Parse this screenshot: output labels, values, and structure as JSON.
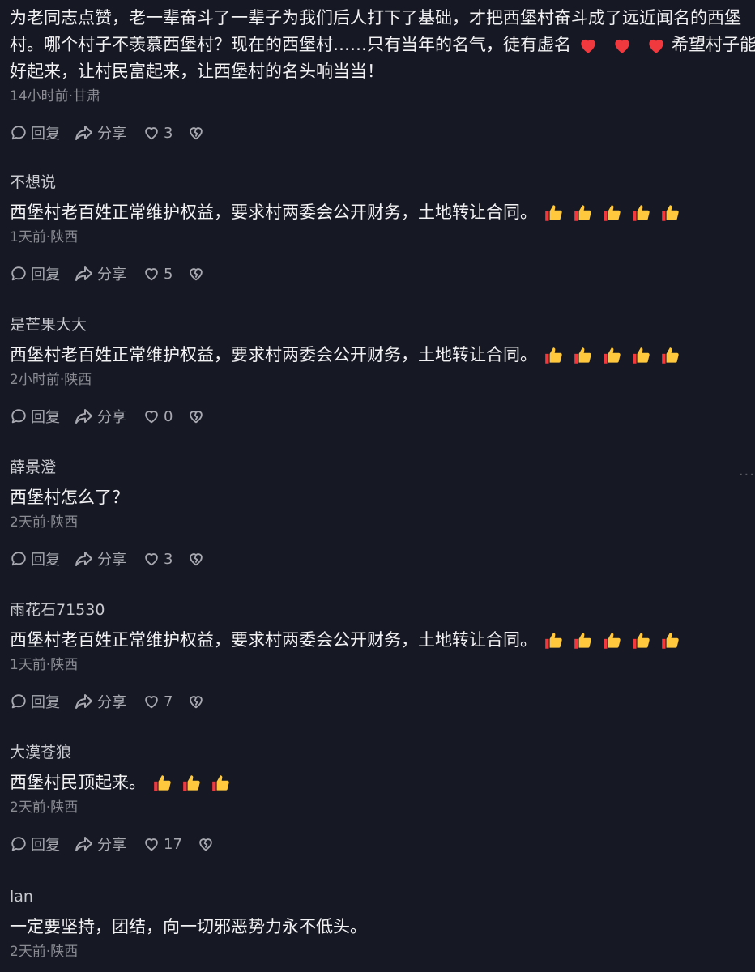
{
  "comments": [
    {
      "username": "",
      "lines": [
        "为老同志点赞，老一辈奋斗了一辈子为我们后人打下了基础，才把西堡村奋斗成了远近闻名的西堡",
        "村。哪个村子不羡慕西堡村？现在的西堡村……只有当年的名气，徒有虚名",
        "希望村子能",
        "好起来，让村民富起来，让西堡村的名头响当当！"
      ],
      "meta": "14小时前·甘肃",
      "reply": "回复",
      "share": "分享",
      "likes": "3"
    },
    {
      "username": "不想说",
      "text": "西堡村老百姓正常维护权益，要求村两委会公开财务，土地转让合同。",
      "emoji_count": 5,
      "meta": "1天前·陕西",
      "reply": "回复",
      "share": "分享",
      "likes": "5"
    },
    {
      "username": "是芒果大大",
      "text": "西堡村老百姓正常维护权益，要求村两委会公开财务，土地转让合同。",
      "emoji_count": 5,
      "meta": "2小时前·陕西",
      "reply": "回复",
      "share": "分享",
      "likes": "0"
    },
    {
      "username": "薛景澄",
      "text": "西堡村怎么了？",
      "emoji_count": 0,
      "meta": "2天前·陕西",
      "reply": "回复",
      "share": "分享",
      "likes": "3"
    },
    {
      "username": "雨花石71530",
      "text": "西堡村老百姓正常维护权益，要求村两委会公开财务，土地转让合同。",
      "emoji_count": 5,
      "meta": "1天前·陕西",
      "reply": "回复",
      "share": "分享",
      "likes": "7"
    },
    {
      "username": "大漠苍狼",
      "text": "西堡村民顶起来。",
      "emoji_count": 3,
      "meta": "2天前·陕西",
      "reply": "回复",
      "share": "分享",
      "likes": "17"
    },
    {
      "username": "lan",
      "text": "一定要坚持，团结，向一切邪恶势力永不低头。",
      "emoji_count": 0,
      "meta": "2天前·陕西"
    }
  ],
  "icons": {
    "reply": "chat-bubble-icon",
    "share": "share-arrow-icon",
    "like": "heart-outline-icon",
    "dislike": "broken-heart-icon",
    "thumbs": "thumbs-up-emoji",
    "heart_emoji": "red-heart-emoji"
  },
  "colors": {
    "background": "#161823",
    "text": "#f1f1f3",
    "meta": "#8a8b93",
    "heart": "#fe2c55"
  }
}
